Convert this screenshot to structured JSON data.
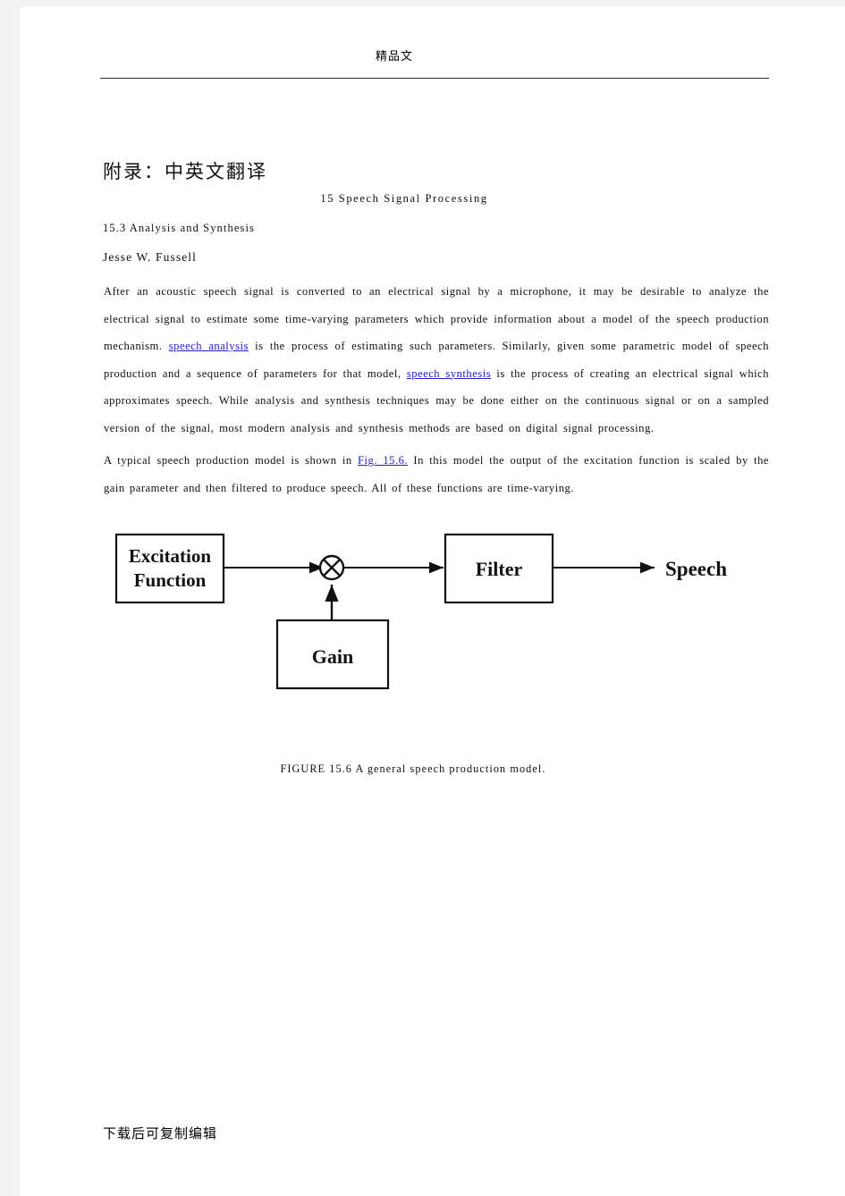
{
  "header": {
    "watermark": "精品文"
  },
  "title": "附录：中英文翻译",
  "chapter_heading": "15 Speech Signal Processing",
  "section_heading": "15.3 Analysis and Synthesis",
  "author": "Jesse W. Fussell",
  "paragraphs": {
    "p1_a": "After an acoustic speech signal is converted to an electrical signal by a microphone, it may be desirable to analyze the electrical signal to estimate some time-varying parameters which provide information about a model of the speech production mechanism. ",
    "p1_link": "speech analysis",
    "p1_b": " is the process of estimating such parameters. Similarly, given some parametric model of speech production and a sequence of parameters for that model, ",
    "p1_link2": "speech synthesis",
    "p1_c": " is the process of creating an electrical signal which approximates speech. While analysis and synthesis techniques may be done either on the continuous signal or on a sampled version of the signal, most modern analysis and synthesis methods are based on digital signal processing.",
    "p2_a": "A typical speech production model is shown in ",
    "p2_link": "Fig. 15.6.",
    "p2_b": " In this model the output of the excitation function is scaled by the gain parameter and then filtered to produce speech. All of these functions are time-varying."
  },
  "figure": {
    "blocks": {
      "excitation_line1": "Excitation",
      "excitation_line2": "Function",
      "gain": "Gain",
      "filter": "Filter",
      "output": "Speech"
    },
    "multiplier_symbol": "⊗",
    "caption": "FIGURE 15.6 A general speech production model."
  },
  "footer": {
    "note": "下载后可复制编辑"
  },
  "colors": {
    "link": "#2222cc",
    "text": "#111111",
    "page": "#ffffff",
    "surround": "#f4f4f4",
    "rule": "#2b2b2b"
  }
}
